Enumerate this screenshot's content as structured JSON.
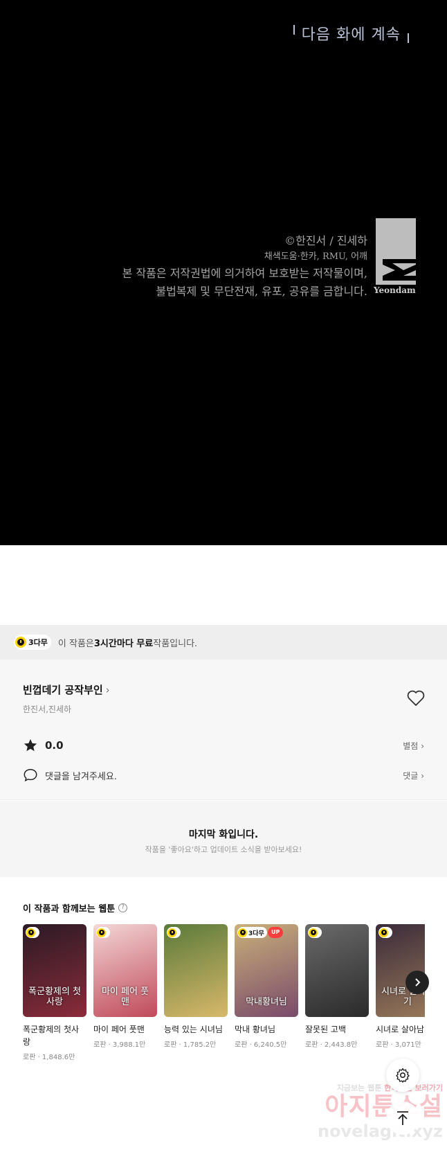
{
  "comic": {
    "next_episode": "다음 화에 계속",
    "copyright": "©한진서 / 진세하",
    "credits": "채색도움·한카, RMU, 어깨",
    "notice_line1": "본 작품은 저작권법에 의거하여 보호받는 저작물이며,",
    "notice_line2": "불법복제 및 무단전재, 유포, 공유를 금합니다.",
    "logo": "Yeondam"
  },
  "banner": {
    "badge": "3다무",
    "text_before": "이 작품은 ",
    "text_bold": "3시간마다 무료",
    "text_after": " 작품입니다."
  },
  "work": {
    "title": "빈껍데기 공작부인",
    "authors": "한진서,진세하",
    "rating": "0.0",
    "rating_link": "별점",
    "comment_prompt": "댓글을 남겨주세요.",
    "comment_link": "댓글"
  },
  "last_episode": {
    "title": "마지막 화입니다.",
    "subtitle": "작품을 '좋아요'하고 업데이트 소식을 받아보세요!"
  },
  "recommendations": {
    "title": "이 작품과 함께보는 웹툰",
    "items": [
      {
        "title": "폭군황제의 첫사랑",
        "meta": "로판 · 1,848.6만",
        "thumb_text": "폭군황제의 첫사랑",
        "badge": "",
        "up": false,
        "color_a": "#2a1a24",
        "color_b": "#8a2b3a"
      },
      {
        "title": "마이 페어 풋맨",
        "meta": "로판 · 3,988.1만",
        "thumb_text": "마이 페어 풋맨",
        "badge": "",
        "up": false,
        "color_a": "#f3d6d6",
        "color_b": "#c04a5a"
      },
      {
        "title": "능력 있는 시녀님",
        "meta": "로판 · 1,785.2만",
        "thumb_text": "",
        "badge": "",
        "up": false,
        "color_a": "#5a7a3a",
        "color_b": "#d8b86a"
      },
      {
        "title": "막내 황녀님",
        "meta": "로판 · 6,240.5만",
        "thumb_text": "막내황녀님",
        "badge": "3다무",
        "up": true,
        "up_label": "UP",
        "color_a": "#c9b07a",
        "color_b": "#7a4a6a"
      },
      {
        "title": "잘못된 고백",
        "meta": "로판 · 2,443.8만",
        "thumb_text": "",
        "badge": "",
        "up": false,
        "color_a": "#6a6a6a",
        "color_b": "#2a2a2a"
      },
      {
        "title": "시녀로 살아남기",
        "meta": "로판 · 3,071만",
        "thumb_text": "시녀로 살아남기",
        "badge": "",
        "up": false,
        "color_a": "#3a2a3a",
        "color_b": "#9a7a5a"
      }
    ]
  },
  "watermark": {
    "line1_a": "지금보는 웹툰 ",
    "line1_b": "한국소설 보러가기",
    "line2": "아지툰소설",
    "line3": "novelagit.xyz"
  }
}
